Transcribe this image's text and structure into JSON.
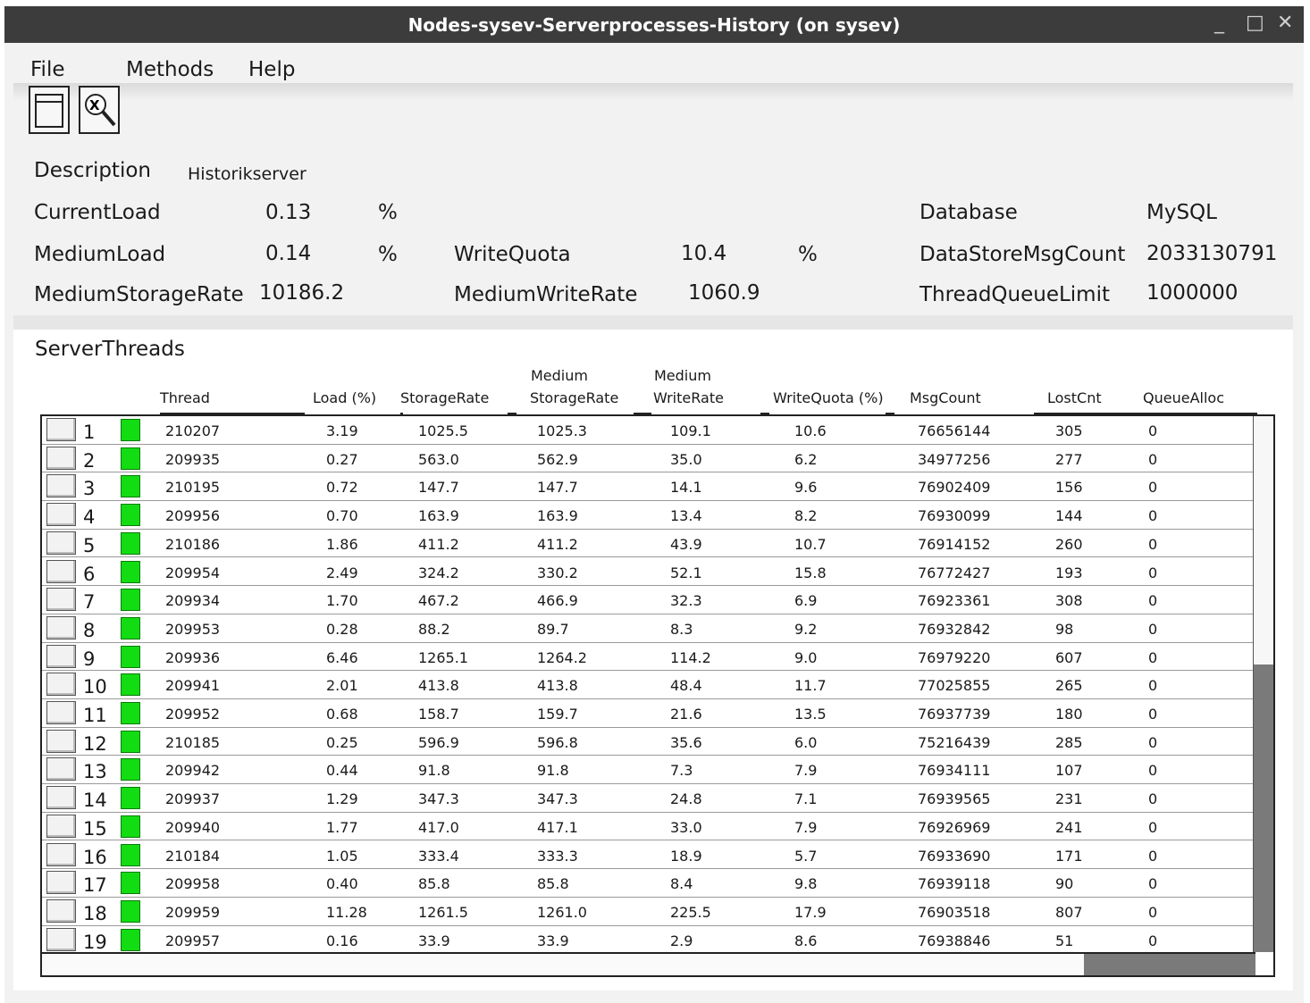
{
  "window": {
    "title": "Nodes-sysev-Serverprocesses-History (on sysev)",
    "minimize": "_",
    "maximize": "□",
    "close": "✕"
  },
  "menu": {
    "file": "File",
    "methods": "Methods",
    "help": "Help"
  },
  "toolbar": {
    "open_icon": "window-icon",
    "stop_icon": "search-close-icon"
  },
  "info": {
    "description_label": "Description",
    "description_value": "Historikserver",
    "current_load_label": "CurrentLoad",
    "current_load_value": "0.13",
    "current_load_unit": "%",
    "medium_load_label": "MediumLoad",
    "medium_load_value": "0.14",
    "medium_load_unit": "%",
    "medium_storage_rate_label": "MediumStorageRate",
    "medium_storage_rate_value": "10186.2",
    "write_quota_label": "WriteQuota",
    "write_quota_value": "10.4",
    "write_quota_unit": "%",
    "medium_write_rate_label": "MediumWriteRate",
    "medium_write_rate_value": "1060.9",
    "database_label": "Database",
    "database_value": "MySQL",
    "datastore_msg_count_label": "DataStoreMsgCount",
    "datastore_msg_count_value": "2033130791",
    "thread_queue_limit_label": "ThreadQueueLimit",
    "thread_queue_limit_value": "1000000"
  },
  "threads": {
    "title": "ServerThreads",
    "headers": {
      "thread": "Thread",
      "load": "Load (%)",
      "storage_rate": "StorageRate",
      "medium_storage_rate_1": "Medium",
      "medium_storage_rate_2": "StorageRate",
      "medium_write_rate_1": "Medium",
      "medium_write_rate_2": "WriteRate",
      "write_quota": "WriteQuota (%)",
      "msg_count": "MsgCount",
      "lost_cnt": "LostCnt",
      "queue_alloc": "QueueAlloc"
    },
    "status_color": "#12dd12",
    "rows": [
      {
        "idx": "1",
        "thread": "210207",
        "load": "3.19",
        "sr": "1025.5",
        "msr": "1025.3",
        "mwr": "109.1",
        "wq": "10.6",
        "mc": "76656144",
        "lc": "305",
        "qa": "0"
      },
      {
        "idx": "2",
        "thread": "209935",
        "load": "0.27",
        "sr": "563.0",
        "msr": "562.9",
        "mwr": "35.0",
        "wq": "6.2",
        "mc": "34977256",
        "lc": "277",
        "qa": "0"
      },
      {
        "idx": "3",
        "thread": "210195",
        "load": "0.72",
        "sr": "147.7",
        "msr": "147.7",
        "mwr": "14.1",
        "wq": "9.6",
        "mc": "76902409",
        "lc": "156",
        "qa": "0"
      },
      {
        "idx": "4",
        "thread": "209956",
        "load": "0.70",
        "sr": "163.9",
        "msr": "163.9",
        "mwr": "13.4",
        "wq": "8.2",
        "mc": "76930099",
        "lc": "144",
        "qa": "0"
      },
      {
        "idx": "5",
        "thread": "210186",
        "load": "1.86",
        "sr": "411.2",
        "msr": "411.2",
        "mwr": "43.9",
        "wq": "10.7",
        "mc": "76914152",
        "lc": "260",
        "qa": "0"
      },
      {
        "idx": "6",
        "thread": "209954",
        "load": "2.49",
        "sr": "324.2",
        "msr": "330.2",
        "mwr": "52.1",
        "wq": "15.8",
        "mc": "76772427",
        "lc": "193",
        "qa": "0"
      },
      {
        "idx": "7",
        "thread": "209934",
        "load": "1.70",
        "sr": "467.2",
        "msr": "466.9",
        "mwr": "32.3",
        "wq": "6.9",
        "mc": "76923361",
        "lc": "308",
        "qa": "0"
      },
      {
        "idx": "8",
        "thread": "209953",
        "load": "0.28",
        "sr": "88.2",
        "msr": "89.7",
        "mwr": "8.3",
        "wq": "9.2",
        "mc": "76932842",
        "lc": "98",
        "qa": "0"
      },
      {
        "idx": "9",
        "thread": "209936",
        "load": "6.46",
        "sr": "1265.1",
        "msr": "1264.2",
        "mwr": "114.2",
        "wq": "9.0",
        "mc": "76979220",
        "lc": "607",
        "qa": "0"
      },
      {
        "idx": "10",
        "thread": "209941",
        "load": "2.01",
        "sr": "413.8",
        "msr": "413.8",
        "mwr": "48.4",
        "wq": "11.7",
        "mc": "77025855",
        "lc": "265",
        "qa": "0"
      },
      {
        "idx": "11",
        "thread": "209952",
        "load": "0.68",
        "sr": "158.7",
        "msr": "159.7",
        "mwr": "21.6",
        "wq": "13.5",
        "mc": "76937739",
        "lc": "180",
        "qa": "0"
      },
      {
        "idx": "12",
        "thread": "210185",
        "load": "0.25",
        "sr": "596.9",
        "msr": "596.8",
        "mwr": "35.6",
        "wq": "6.0",
        "mc": "75216439",
        "lc": "285",
        "qa": "0"
      },
      {
        "idx": "13",
        "thread": "209942",
        "load": "0.44",
        "sr": "91.8",
        "msr": "91.8",
        "mwr": "7.3",
        "wq": "7.9",
        "mc": "76934111",
        "lc": "107",
        "qa": "0"
      },
      {
        "idx": "14",
        "thread": "209937",
        "load": "1.29",
        "sr": "347.3",
        "msr": "347.3",
        "mwr": "24.8",
        "wq": "7.1",
        "mc": "76939565",
        "lc": "231",
        "qa": "0"
      },
      {
        "idx": "15",
        "thread": "209940",
        "load": "1.77",
        "sr": "417.0",
        "msr": "417.1",
        "mwr": "33.0",
        "wq": "7.9",
        "mc": "76926969",
        "lc": "241",
        "qa": "0"
      },
      {
        "idx": "16",
        "thread": "210184",
        "load": "1.05",
        "sr": "333.4",
        "msr": "333.3",
        "mwr": "18.9",
        "wq": "5.7",
        "mc": "76933690",
        "lc": "171",
        "qa": "0"
      },
      {
        "idx": "17",
        "thread": "209958",
        "load": "0.40",
        "sr": "85.8",
        "msr": "85.8",
        "mwr": "8.4",
        "wq": "9.8",
        "mc": "76939118",
        "lc": "90",
        "qa": "0"
      },
      {
        "idx": "18",
        "thread": "209959",
        "load": "11.28",
        "sr": "1261.5",
        "msr": "1261.0",
        "mwr": "225.5",
        "wq": "17.9",
        "mc": "76903518",
        "lc": "807",
        "qa": "0"
      },
      {
        "idx": "19",
        "thread": "209957",
        "load": "0.16",
        "sr": "33.9",
        "msr": "33.9",
        "mwr": "2.9",
        "wq": "8.6",
        "mc": "76938846",
        "lc": "51",
        "qa": "0"
      }
    ]
  }
}
